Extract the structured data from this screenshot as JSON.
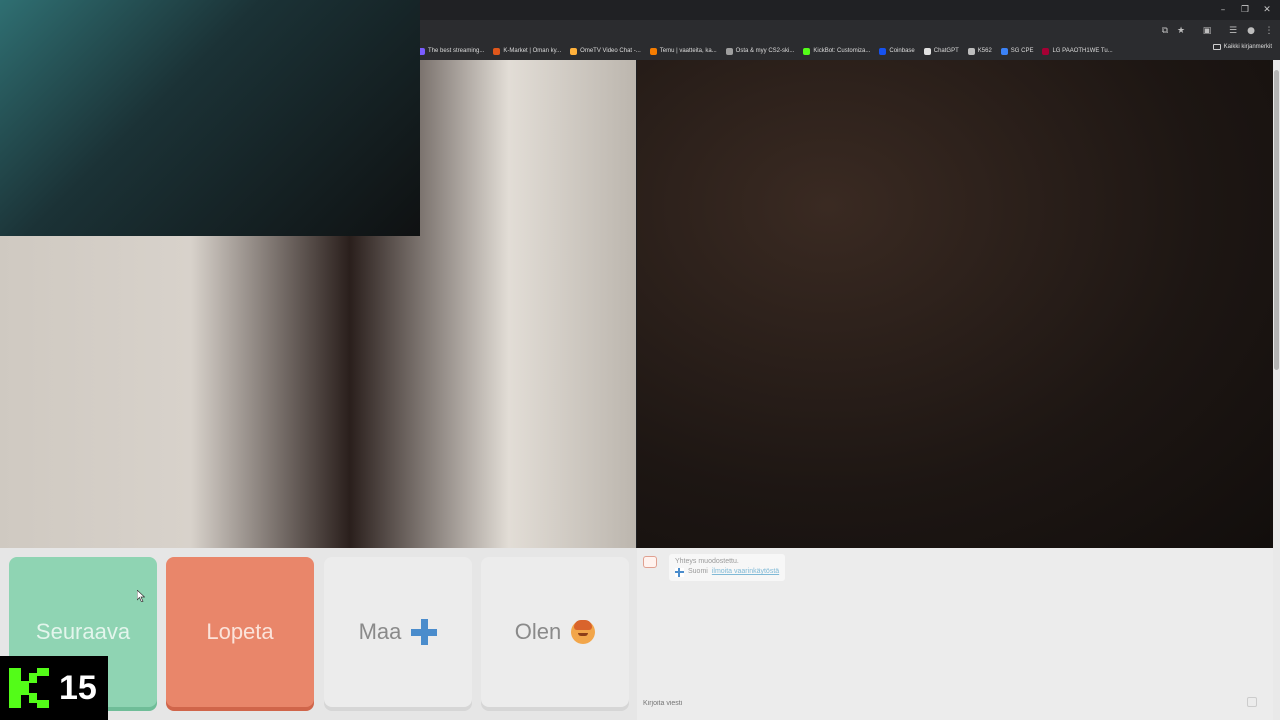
{
  "browser": {
    "bookmarks": [
      {
        "label": "The best streaming...",
        "color": "#7a5cff"
      },
      {
        "label": "K-Market | Oman ky...",
        "color": "#e0571b"
      },
      {
        "label": "OmeTV Video Chat -...",
        "color": "#ffb13b"
      },
      {
        "label": "Temu | vaatteita, ka...",
        "color": "#f57c00"
      },
      {
        "label": "Osta & myy CS2-ski...",
        "color": "#9e9e9e"
      },
      {
        "label": "KickBot: Customiza...",
        "color": "#53fc18"
      },
      {
        "label": "Coinbase",
        "color": "#1652f0"
      },
      {
        "label": "ChatGPT",
        "color": "#e0e0e0"
      },
      {
        "label": "K562",
        "color": "#bdbdbd"
      },
      {
        "label": "SG CPE",
        "color": "#3b82f6"
      },
      {
        "label": "LG PAAOTH1WE Tu...",
        "color": "#a50034"
      }
    ],
    "all_bookmarks_label": "Kaikki kirjanmerkit"
  },
  "controls": {
    "next_label": "Seuraava",
    "stop_label": "Lopeta",
    "country_label": "Maa",
    "gender_label": "Olen"
  },
  "chat": {
    "status_message": "Yhteys muodostettu.",
    "country_text": "Suomi",
    "report_link": "ilmoita vaarinkäytöstä",
    "input_placeholder": "Kirjoita viesti"
  },
  "overlay": {
    "kick_follower_count": "15"
  },
  "colors": {
    "next_button": "#8fd4b3",
    "stop_button": "#e9866a",
    "kick_brand": "#53fc18"
  },
  "icons": {
    "country_flag": "finland-flag-icon",
    "gender_avatar": "boy-face-icon",
    "kick_logo": "kick-logo-icon"
  }
}
